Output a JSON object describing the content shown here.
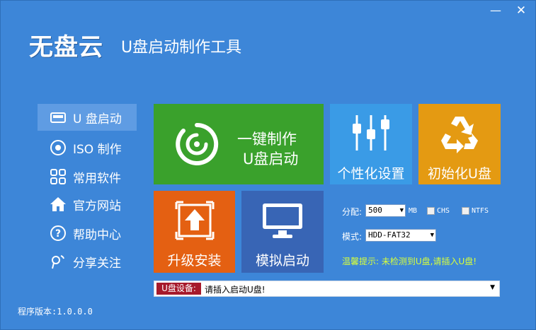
{
  "window": {
    "minimize_icon": "minimize-icon",
    "close_icon": "close-icon",
    "minimize_glyph": "—",
    "close_glyph": "✕"
  },
  "header": {
    "logo": "无盘云",
    "title": "U盘启动制作工具"
  },
  "sidebar": {
    "items": [
      {
        "label": "U 盘启动",
        "icon": "usb-drive-icon",
        "active": true
      },
      {
        "label": "ISO 制作",
        "icon": "disc-icon",
        "active": false
      },
      {
        "label": "常用软件",
        "icon": "apps-grid-icon",
        "active": false
      },
      {
        "label": "官方网站",
        "icon": "home-icon",
        "active": false
      },
      {
        "label": "帮助中心",
        "icon": "help-icon",
        "active": false
      },
      {
        "label": "分享关注",
        "icon": "share-icon",
        "active": false
      }
    ]
  },
  "tiles": {
    "onekey": {
      "line1": "一键制作",
      "line2": "U盘启动",
      "icon": "power-disc-icon",
      "color": "#3aa12c"
    },
    "personal": {
      "label": "个性化设置",
      "icon": "sliders-icon",
      "color": "#3a9be6"
    },
    "init": {
      "label": "初始化U盘",
      "icon": "recycle-icon",
      "color": "#e49a12"
    },
    "upgrade": {
      "label": "升级安装",
      "icon": "upgrade-icon",
      "color": "#e46012"
    },
    "simulate": {
      "label": "模拟启动",
      "icon": "monitor-icon",
      "color": "#3865b5"
    }
  },
  "options": {
    "alloc_label": "分配:",
    "alloc_value": "500",
    "alloc_unit": "MB",
    "chs_label": "CHS",
    "ntfs_label": "NTFS",
    "mode_label": "模式:",
    "mode_value": "HDD-FAT32",
    "tip": "温馨提示: 未检测到U盘,请插入U盘!"
  },
  "device": {
    "label": "U盘设备:",
    "value": "请插入启动U盘!"
  },
  "footer": {
    "version": "程序版本:1.0.0.0"
  }
}
